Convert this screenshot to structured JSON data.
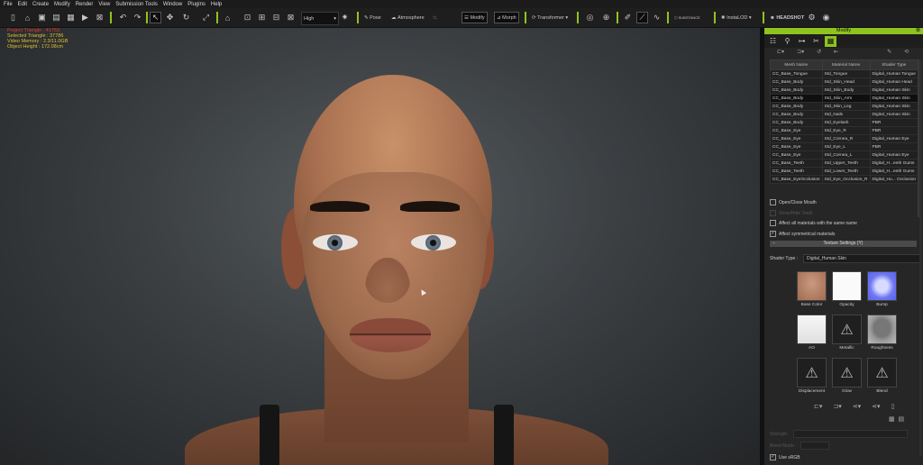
{
  "menu": [
    "File",
    "Edit",
    "Create",
    "Modify",
    "Render",
    "View",
    "Submission Tools",
    "Window",
    "Plugins",
    "Help"
  ],
  "toolbar": {
    "quality_value": "High",
    "pose_label": "Pose",
    "atmosphere_label": "Atmosphere",
    "modify_label": "Modify",
    "morph_label": "Morph",
    "transformer_label": "Transformer",
    "substance_label": "SUBSTANCE",
    "instalod_label": "InstaLOD",
    "headshot_label": "HEADSHOT"
  },
  "viewport": {
    "stats": [
      "Project Triangle : 41753",
      "Selected Triangle : 37786",
      "Video Memory : 2.3/11.0GB",
      "Object Height : 172.08cm"
    ]
  },
  "panel": {
    "title": "Modify",
    "table": {
      "headers": [
        "Mesh Name",
        "Material Name",
        "Shader Type"
      ],
      "selected_index": 3,
      "rows": [
        [
          "CC_Base_Tongue",
          "Std_Tongue",
          "Digital_Human Tongue"
        ],
        [
          "CC_Base_Body",
          "Std_Skin_Head",
          "Digital_Human Head"
        ],
        [
          "CC_Base_Body",
          "Std_Skin_Body",
          "Digital_Human Skin"
        ],
        [
          "CC_Base_Body",
          "Std_Skin_Arm",
          "Digital_Human Skin"
        ],
        [
          "CC_Base_Body",
          "Std_Skin_Leg",
          "Digital_Human Skin"
        ],
        [
          "CC_Base_Body",
          "Std_Nails",
          "Digital_Human Skin"
        ],
        [
          "CC_Base_Body",
          "Std_Eyelash",
          "PBR"
        ],
        [
          "CC_Base_Eye",
          "Std_Eye_R",
          "PBR"
        ],
        [
          "CC_Base_Eye",
          "Std_Cornea_R",
          "Digital_Human Eye"
        ],
        [
          "CC_Base_Eye",
          "Std_Eye_L",
          "PBR"
        ],
        [
          "CC_Base_Eye",
          "Std_Cornea_L",
          "Digital_Human Eye"
        ],
        [
          "CC_Base_Teeth",
          "Std_Upper_Teeth",
          "Digital_H...eeth Gums"
        ],
        [
          "CC_Base_Teeth",
          "Std_Lower_Teeth",
          "Digital_H...eeth Gums"
        ],
        [
          "CC_Base_EyeOcclusion",
          "Std_Eye_Occlusion_R",
          "Digital_Hu... Occlusion"
        ]
      ]
    },
    "open_close_mouth": "Open/Close Mouth",
    "hide_teeth": "Show/Hide Teeth",
    "affect_same_name": "Affect all materials with the same name",
    "affect_symmetrical": "Affect symmetrical materials",
    "texture_settings": "Texture Settings (Y)",
    "shader_type_label": "Shader Type :",
    "shader_type_value": "Digital_Human Skin",
    "textures": [
      "Base Color",
      "Opacity",
      "Bump",
      "AO",
      "Metallic",
      "Roughness",
      "Displacement",
      "Glow",
      "Blend"
    ],
    "strength_label": "Strength:",
    "blend_mode_label": "Blend Mode:",
    "use_srgb": "Use sRGB"
  }
}
